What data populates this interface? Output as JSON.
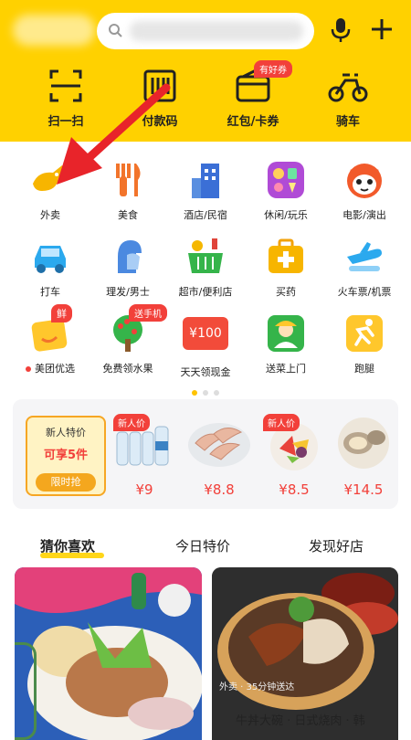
{
  "header": {
    "quick_actions": [
      {
        "label": "扫一扫",
        "icon": "scan-icon"
      },
      {
        "label": "付款码",
        "icon": "barcode-icon"
      },
      {
        "label": "红包/卡券",
        "icon": "wallet-icon",
        "badge": "有好券"
      },
      {
        "label": "骑车",
        "icon": "bike-icon"
      }
    ],
    "icons": [
      "search-icon",
      "mic-icon",
      "plus-icon"
    ]
  },
  "grid": [
    {
      "label": "外卖",
      "icon": "delivery-icon"
    },
    {
      "label": "美食",
      "icon": "fork-knife-icon"
    },
    {
      "label": "酒店/民宿",
      "icon": "hotel-icon"
    },
    {
      "label": "休闲/玩乐",
      "icon": "leisure-icon"
    },
    {
      "label": "电影/演出",
      "icon": "cat-icon"
    },
    {
      "label": "打车",
      "icon": "car-icon"
    },
    {
      "label": "理发/男士",
      "icon": "barber-icon"
    },
    {
      "label": "超市/便利店",
      "icon": "basket-icon"
    },
    {
      "label": "买药",
      "icon": "medicine-icon"
    },
    {
      "label": "火车票/机票",
      "icon": "plane-icon"
    },
    {
      "label": "美团优选",
      "icon": "youxuan-icon",
      "badge": "鲜"
    },
    {
      "label": "免费领水果",
      "icon": "tree-icon",
      "badge": "送手机"
    },
    {
      "label": "天天领现金",
      "icon": "cash-icon",
      "icon_text": "¥100"
    },
    {
      "label": "送菜上门",
      "icon": "grocer-icon"
    },
    {
      "label": "跑腿",
      "icon": "runner-icon"
    }
  ],
  "new_user": {
    "promo_line1": "新人特价",
    "promo_line2": "可享5件",
    "promo_button": "限时抢",
    "products": [
      {
        "tag": "新人价",
        "price": "¥9",
        "icon": "water-bottles-icon"
      },
      {
        "tag": "",
        "price": "¥8.8",
        "icon": "shrimp-icon"
      },
      {
        "tag": "新人价",
        "price": "¥8.5",
        "icon": "fruit-platter-icon"
      },
      {
        "tag": "",
        "price": "¥14.5",
        "icon": "oyster-icon"
      }
    ]
  },
  "tabs": [
    {
      "label": "猜你喜欢",
      "active": true
    },
    {
      "label": "今日特价",
      "active": false
    },
    {
      "label": "发现好店",
      "active": false
    }
  ],
  "feed": {
    "card2_caption": "外卖 · 35分钟送达",
    "card2_title": "牛丼大碗 · 日式烧肉 · 韩"
  },
  "colors": {
    "brand_yellow": "#FFD100",
    "accent_red": "#F2403A",
    "arrow": "#E8242A"
  }
}
